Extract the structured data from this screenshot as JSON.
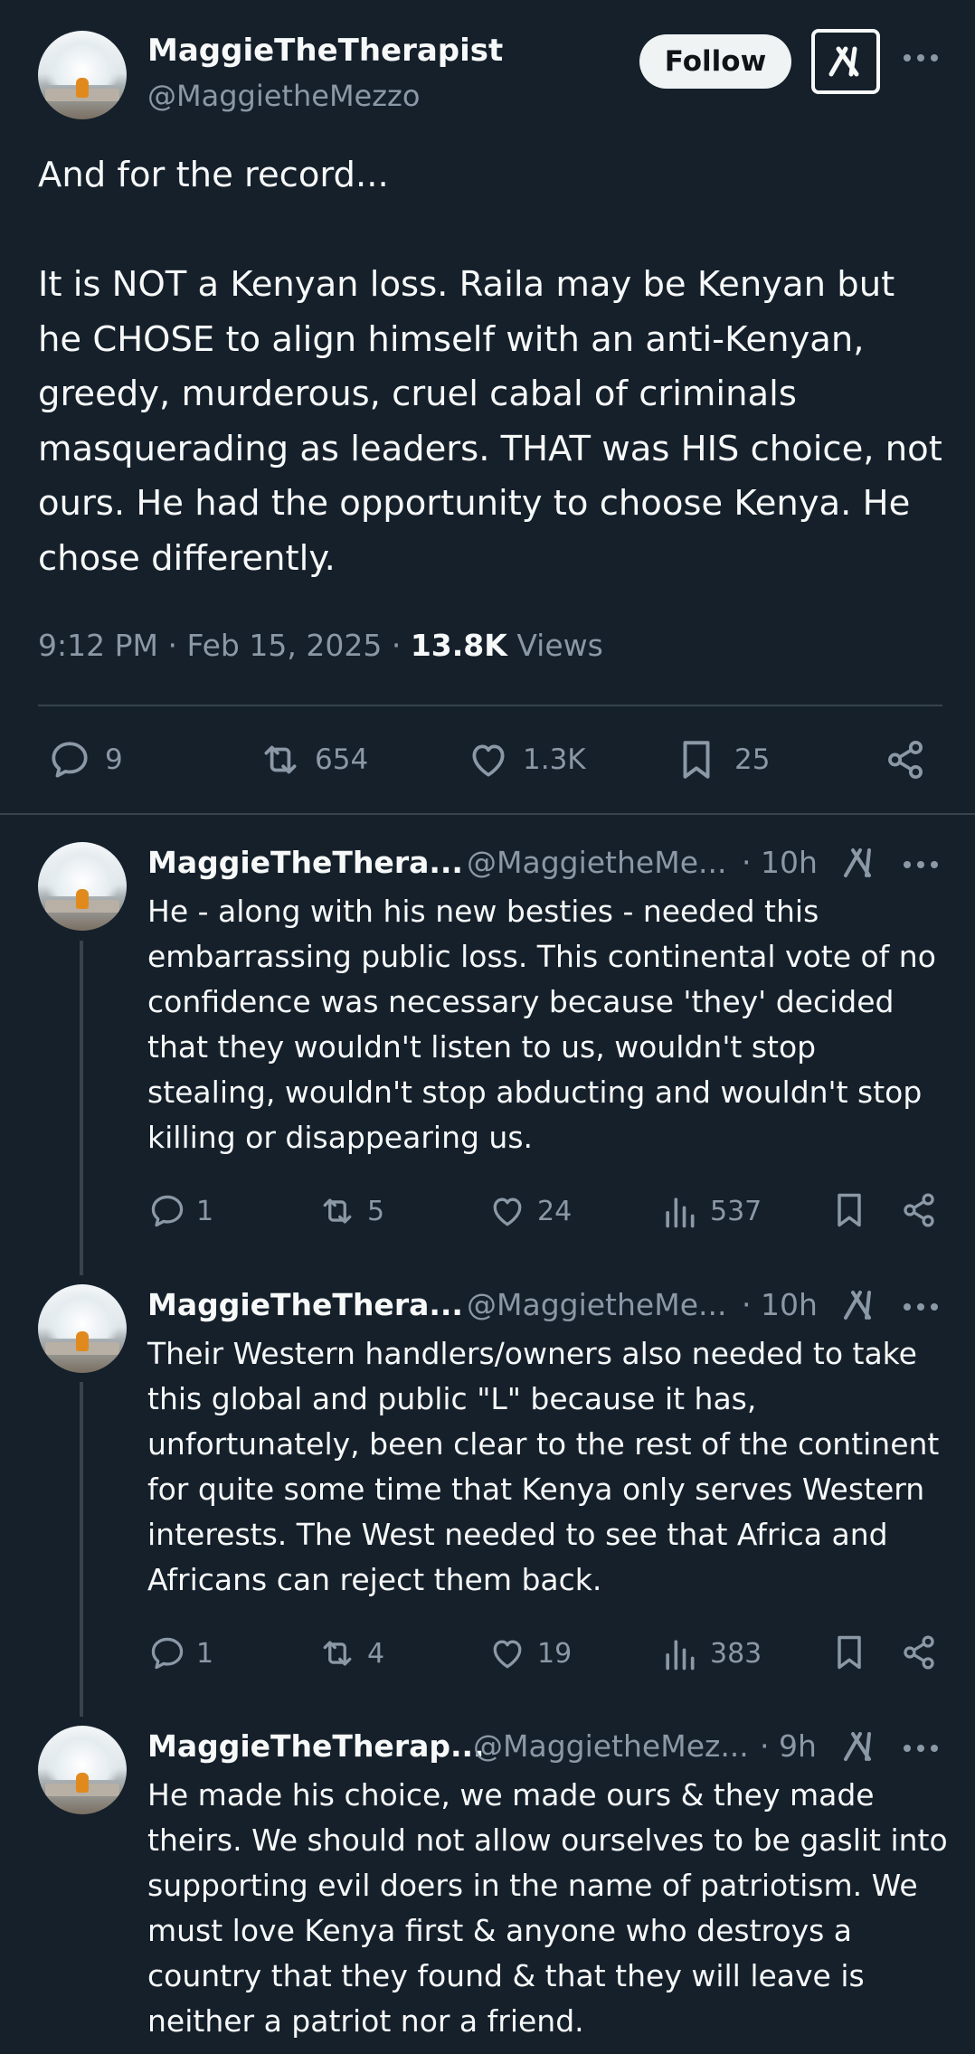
{
  "main": {
    "name": "MaggieTheTherapist",
    "handle": "@MaggietheMezzo",
    "follow_label": "Follow",
    "text": "And for the record...\n\nIt is NOT a Kenyan loss. Raila may be Kenyan but he CHOSE to align himself with an anti-Kenyan, greedy, murderous, cruel cabal of criminals masquerading as leaders. THAT was HIS choice, not ours. He had the opportunity to choose Kenya. He chose differently.",
    "time": "9:12 PM",
    "date": "Feb 15, 2025",
    "views_count": "13.8K",
    "views_label": "Views",
    "replies": "9",
    "reposts": "654",
    "likes": "1.3K",
    "bookmarks": "25"
  },
  "replies": [
    {
      "name": "MaggieTheThera...",
      "handle": "@MaggietheMe...",
      "time": "· 10h",
      "text": "He - along with his new besties - needed this embarrassing public loss. This continental vote of no confidence was necessary because 'they' decided that they wouldn't listen to us, wouldn't stop stealing, wouldn't stop abducting and wouldn't stop killing or disappearing us.",
      "replies": "1",
      "reposts": "5",
      "likes": "24",
      "views": "537"
    },
    {
      "name": "MaggieTheThera...",
      "handle": "@MaggietheMe...",
      "time": "· 10h",
      "text": "Their Western handlers/owners also needed to take this global and public \"L\" because it has, unfortunately, been clear to the rest of the continent for quite some time that Kenya only serves Western interests. The West needed to see that Africa and Africans can reject them back.",
      "replies": "1",
      "reposts": "4",
      "likes": "19",
      "views": "383"
    },
    {
      "name": "MaggieTheTherap...",
      "handle": "@MaggietheMez...",
      "time": "· 9h",
      "text": "He made his choice, we made ours & they made theirs. We should not allow ourselves to be gaslit into supporting evil doers in the name of patriotism. We must love Kenya first & anyone who destroys a country that they found & that they will leave is neither a patriot nor a friend."
    }
  ]
}
